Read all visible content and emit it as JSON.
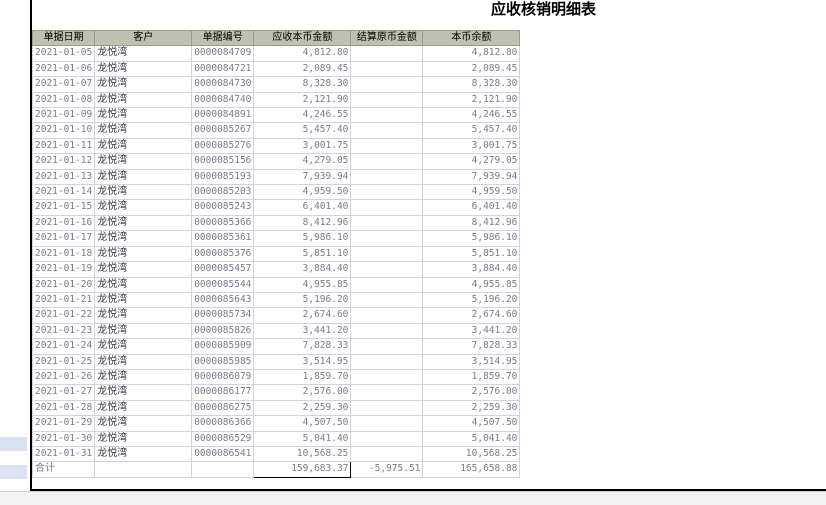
{
  "report": {
    "title": "应收核销明细表"
  },
  "table": {
    "headers": [
      "单据日期",
      "客户",
      "单据编号",
      "应收本币金额",
      "结算原币金额",
      "本币余额"
    ],
    "rows": [
      [
        "2021-01-05",
        "龙悦湾",
        "0000084709",
        "4,812.80",
        "",
        "4,812.80"
      ],
      [
        "2021-01-06",
        "龙悦湾",
        "0000084721",
        "2,089.45",
        "",
        "2,089.45"
      ],
      [
        "2021-01-07",
        "龙悦湾",
        "0000084730",
        "8,328.30",
        "",
        "8,328.30"
      ],
      [
        "2021-01-08",
        "龙悦湾",
        "0000084740",
        "2,121.90",
        "",
        "2,121.90"
      ],
      [
        "2021-01-09",
        "龙悦湾",
        "0000084891",
        "4,246.55",
        "",
        "4,246.55"
      ],
      [
        "2021-01-10",
        "龙悦湾",
        "0000085267",
        "5,457.40",
        "",
        "5,457.40"
      ],
      [
        "2021-01-11",
        "龙悦湾",
        "0000085276",
        "3,001.75",
        "",
        "3,001.75"
      ],
      [
        "2021-01-12",
        "龙悦湾",
        "0000085156",
        "4,279.05",
        "",
        "4,279.05"
      ],
      [
        "2021-01-13",
        "龙悦湾",
        "0000085193",
        "7,939.94",
        "",
        "7,939.94"
      ],
      [
        "2021-01-14",
        "龙悦湾",
        "0000085203",
        "4,959.50",
        "",
        "4,959.50"
      ],
      [
        "2021-01-15",
        "龙悦湾",
        "0000085243",
        "6,401.40",
        "",
        "6,401.40"
      ],
      [
        "2021-01-16",
        "龙悦湾",
        "0000085366",
        "8,412.96",
        "",
        "8,412.96"
      ],
      [
        "2021-01-17",
        "龙悦湾",
        "0000085361",
        "5,986.10",
        "",
        "5,986.10"
      ],
      [
        "2021-01-18",
        "龙悦湾",
        "0000085376",
        "5,851.10",
        "",
        "5,851.10"
      ],
      [
        "2021-01-19",
        "龙悦湾",
        "0000085457",
        "3,884.40",
        "",
        "3,884.40"
      ],
      [
        "2021-01-20",
        "龙悦湾",
        "0000085544",
        "4,955.85",
        "",
        "4,955.85"
      ],
      [
        "2021-01-21",
        "龙悦湾",
        "0000085643",
        "5,196.20",
        "",
        "5,196.20"
      ],
      [
        "2021-01-22",
        "龙悦湾",
        "0000085734",
        "2,674.60",
        "",
        "2,674.60"
      ],
      [
        "2021-01-23",
        "龙悦湾",
        "0000085826",
        "3,441.20",
        "",
        "3,441.20"
      ],
      [
        "2021-01-24",
        "龙悦湾",
        "0000085909",
        "7,828.33",
        "",
        "7,828.33"
      ],
      [
        "2021-01-25",
        "龙悦湾",
        "0000085985",
        "3,514.95",
        "",
        "3,514.95"
      ],
      [
        "2021-01-26",
        "龙悦湾",
        "0000086079",
        "1,859.70",
        "",
        "1,859.70"
      ],
      [
        "2021-01-27",
        "龙悦湾",
        "0000086177",
        "2,576.00",
        "",
        "2,576.00"
      ],
      [
        "2021-01-28",
        "龙悦湾",
        "0000086275",
        "2,259.30",
        "",
        "2,259.30"
      ],
      [
        "2021-01-29",
        "龙悦湾",
        "0000086366",
        "4,507.50",
        "",
        "4,507.50"
      ],
      [
        "2021-01-30",
        "龙悦湾",
        "0000086529",
        "5,041.40",
        "",
        "5,041.40"
      ],
      [
        "2021-01-31",
        "龙悦湾",
        "0000086541",
        "10,568.25",
        "",
        "10,568.25"
      ]
    ],
    "total": {
      "label": "合计",
      "receivable": "159,683.37",
      "settled": "-5,975.51",
      "balance": "165,658.88"
    }
  },
  "colors": {
    "header_bg": "#c0c0b0",
    "cell_text": "#7a7a90",
    "grid_line": "#d3d3df",
    "selection_mark": "#d9e1f2"
  }
}
